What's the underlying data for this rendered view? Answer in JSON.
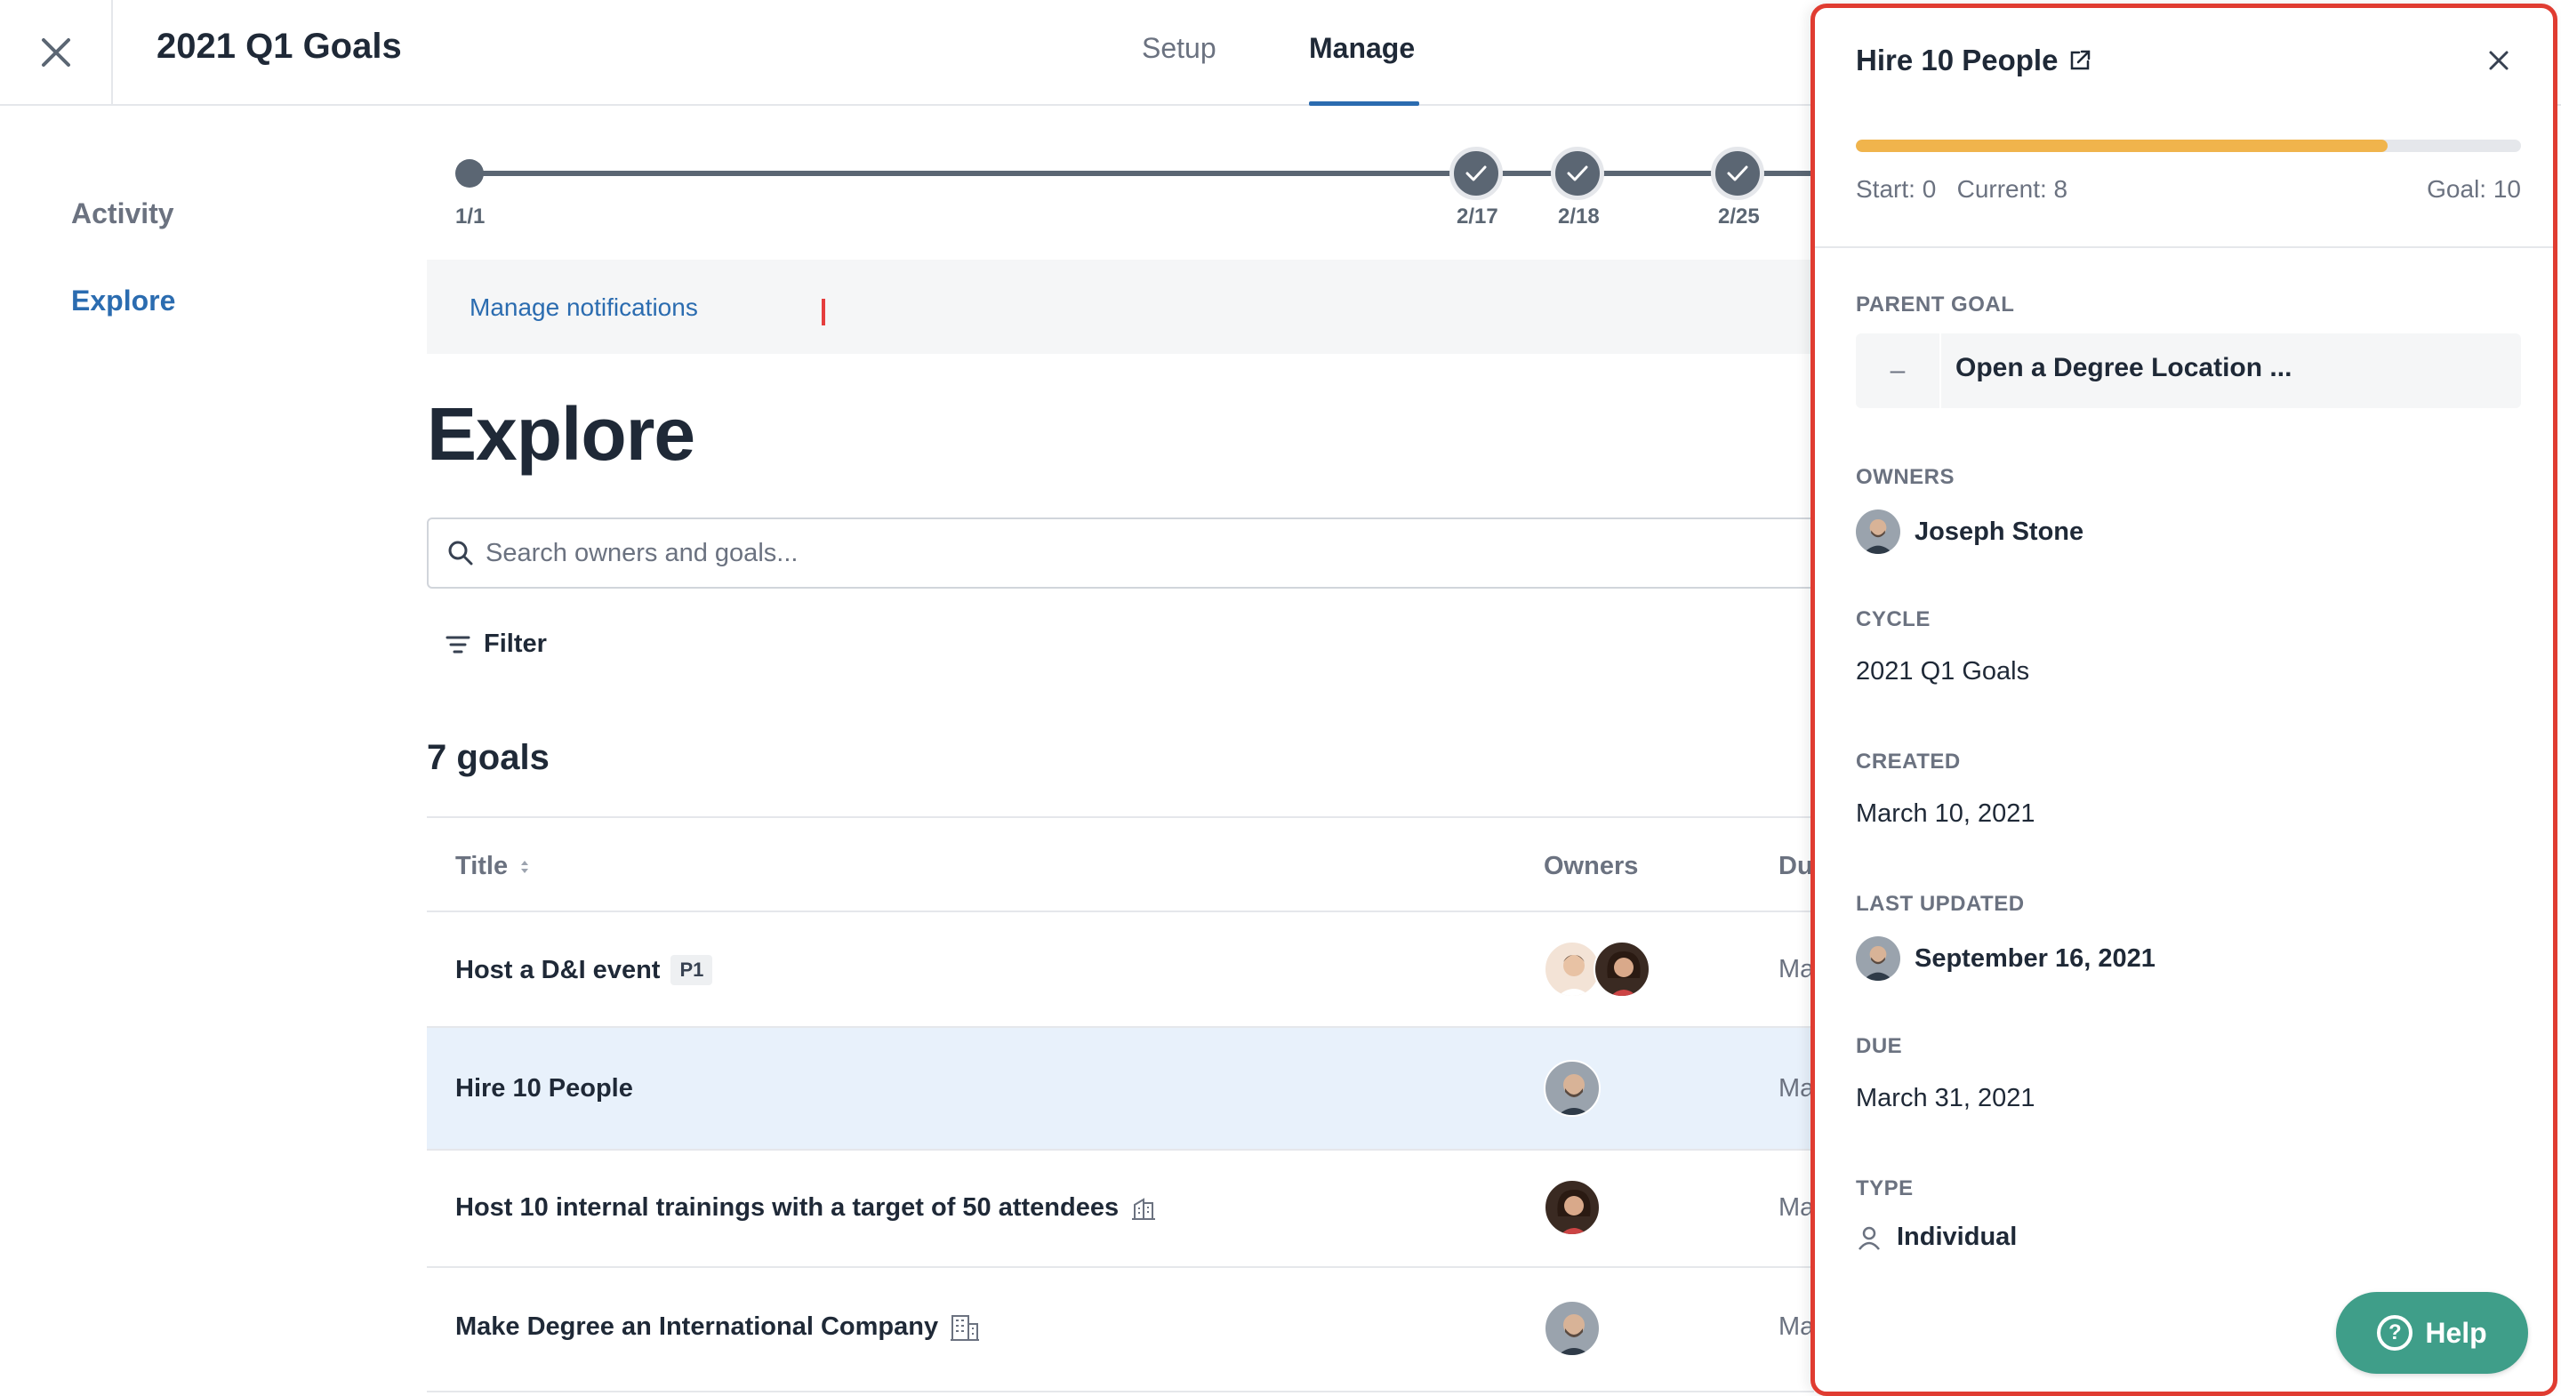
{
  "header": {
    "cycle_title": "2021 Q1 Goals",
    "tabs": [
      {
        "label": "Setup",
        "active": false
      },
      {
        "label": "Manage",
        "active": true
      }
    ]
  },
  "nav": {
    "activity": "Activity",
    "explore": "Explore"
  },
  "timeline": {
    "start_label": "1/1",
    "checkpoints": [
      "2/17",
      "2/18",
      "2/25"
    ]
  },
  "notifications": {
    "link": "Manage notifications"
  },
  "page_title": "Explore",
  "search": {
    "placeholder": "Search owners and goals..."
  },
  "filter_label": "Filter",
  "goal_count": "7 goals",
  "table": {
    "columns": {
      "title": "Title",
      "owners": "Owners",
      "due": "Du"
    },
    "rows": [
      {
        "title": "Host a D&I event",
        "tag": "P1",
        "due": "Ma",
        "selected": false
      },
      {
        "title": "Hire 10 People",
        "tag": "",
        "due": "Ma",
        "selected": true
      },
      {
        "title": "Host 10 internal trainings with a target of 50 attendees",
        "tag": "",
        "due": "Ma",
        "selected": false
      },
      {
        "title": "Make Degree an International Company",
        "tag": "",
        "due": "Ma",
        "selected": false
      }
    ]
  },
  "panel": {
    "title": "Hire 10 People",
    "progress": {
      "start": 0,
      "current": 8,
      "goal": 10,
      "fraction": 0.8
    },
    "start_text": "Start: 0",
    "current_text": "Current: 8",
    "goal_text": "Goal: 10",
    "parent_goal_label": "PARENT GOAL",
    "parent_dash": "–",
    "parent_goal": "Open a Degree Location ...",
    "owners_label": "OWNERS",
    "owner": "Joseph Stone",
    "cycle_label": "CYCLE",
    "cycle": "2021 Q1 Goals",
    "created_label": "CREATED",
    "created": "March 10, 2021",
    "updated_label": "LAST UPDATED",
    "updated": "September 16, 2021",
    "due_label": "DUE",
    "due": "March 31, 2021",
    "type_label": "TYPE",
    "type": "Individual",
    "help": "Help",
    "help_glyph": "?"
  },
  "colors": {
    "accent": "#2b6cb0",
    "progress": "#f0b44c",
    "help": "#3f9e89",
    "panel_border": "#e03c31",
    "selected_row": "#e8f1fb"
  }
}
